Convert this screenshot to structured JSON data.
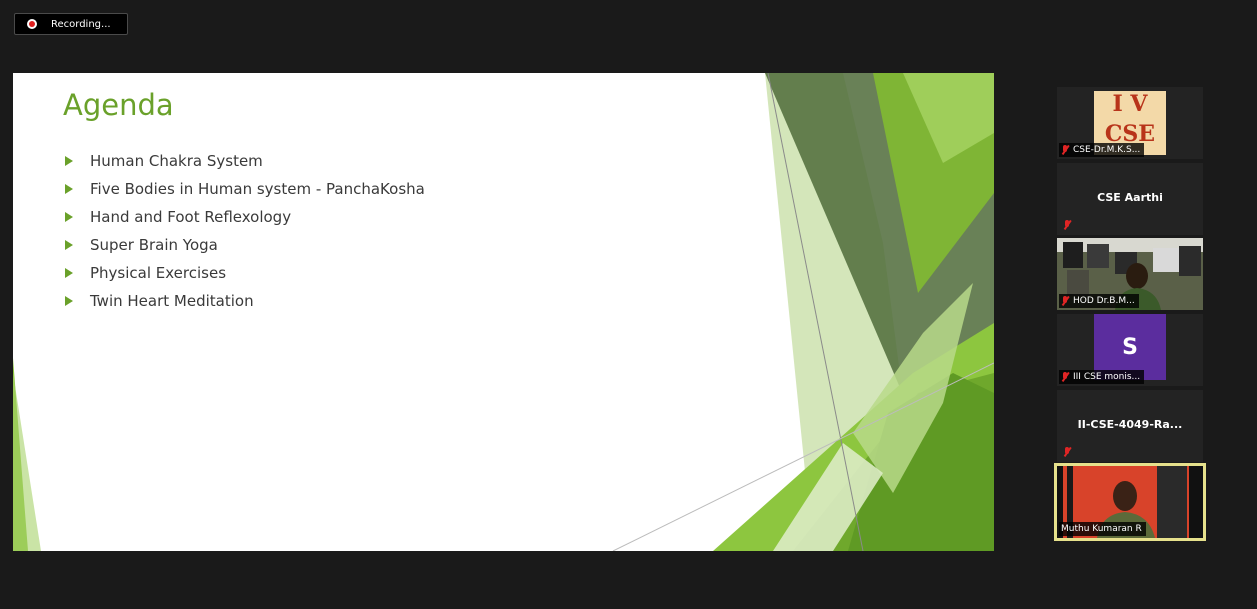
{
  "recording": {
    "label": "Recording..."
  },
  "slide": {
    "title": "Agenda",
    "items": [
      "Human Chakra System",
      "Five Bodies in Human system - PanchaKosha",
      "Hand and Foot Reflexology",
      "Super Brain Yoga",
      "Physical Exercises",
      "Twin Heart Meditation"
    ],
    "accent_color": "#6aa12a"
  },
  "participants": [
    {
      "name": "CSE-Dr.M.K.S...",
      "logo_line1": "I V",
      "logo_line2": "CSE",
      "muted": true
    },
    {
      "name": "CSE Aarthi",
      "muted": true
    },
    {
      "name": "HOD Dr.B.M...",
      "muted": true
    },
    {
      "name": "III CSE monis...",
      "avatar_letter": "S",
      "muted": true
    },
    {
      "name": "II-CSE-4049-Ra...",
      "muted": true
    },
    {
      "name": "Muthu Kumaran R",
      "muted": false,
      "active_speaker": true
    }
  ]
}
